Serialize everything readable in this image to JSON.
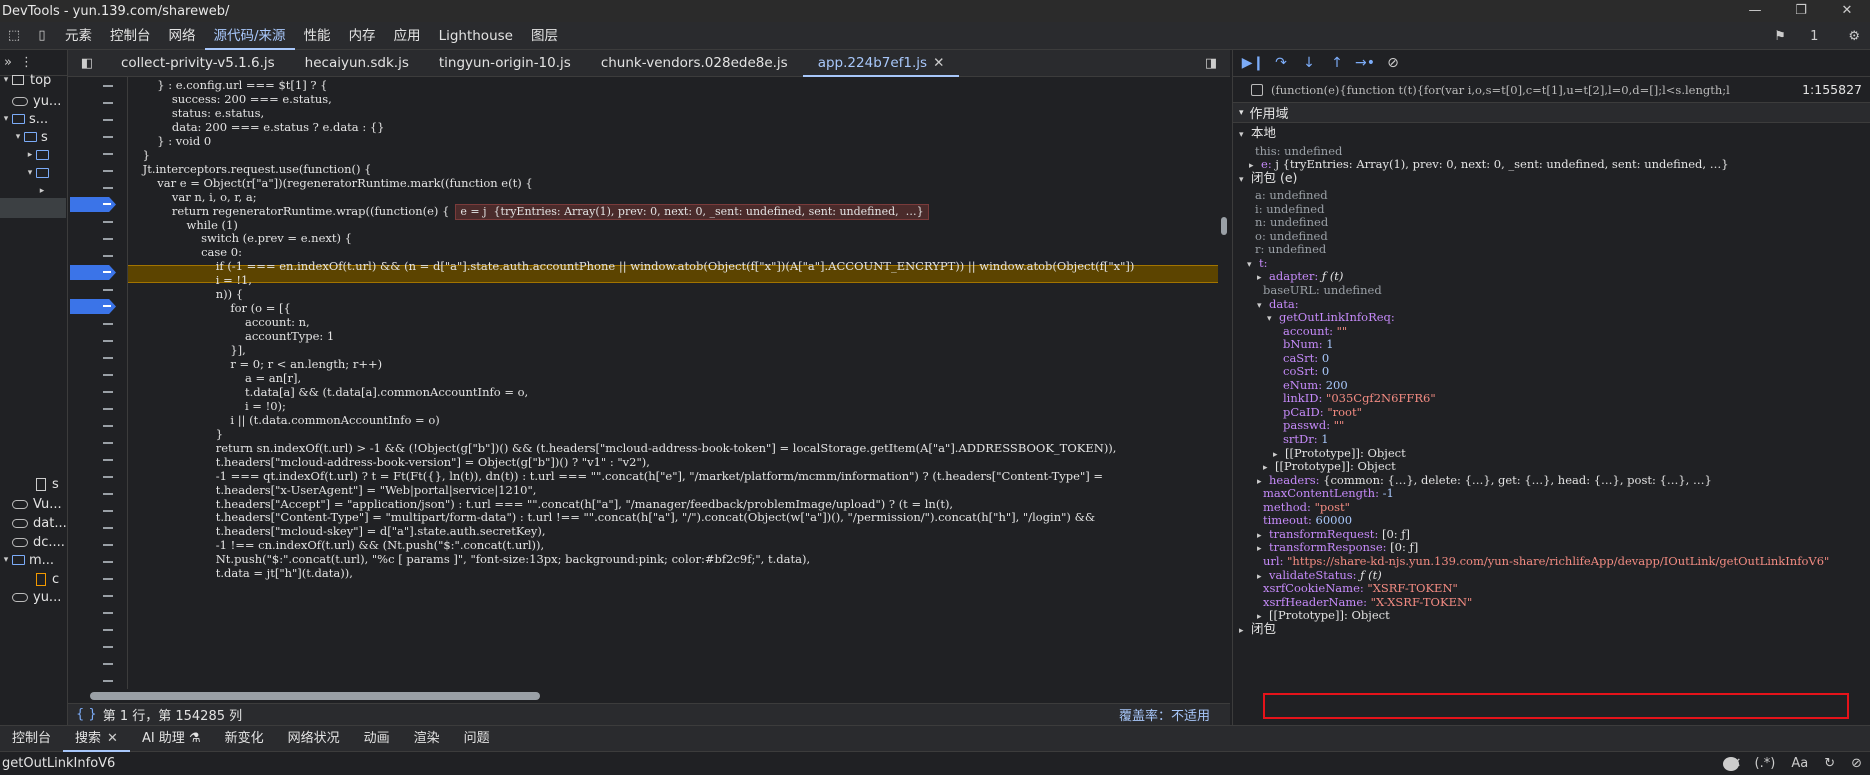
{
  "window": {
    "title": "DevTools - yun.139.com/shareweb/"
  },
  "main_tabs": [
    "元素",
    "控制台",
    "网络",
    "源代码/来源",
    "性能",
    "内存",
    "应用",
    "Lighthouse",
    "图层"
  ],
  "active_main_tab": "源代码/来源",
  "issues_count": "1",
  "file_tree": [
    {
      "label": "top",
      "icon": "window-icon"
    },
    {
      "label": "yu...",
      "icon": "cloud-icon"
    },
    {
      "label": "s...",
      "icon": "folder-icon"
    },
    {
      "label": "s",
      "icon": "folder-icon"
    },
    {
      "label": "",
      "icon": "folder-icon"
    },
    {
      "label": "",
      "icon": "folder-icon"
    },
    {
      "label": "s",
      "icon": "file-icon"
    },
    {
      "label": "Vu...",
      "icon": "cloud-icon"
    },
    {
      "label": "dat...",
      "icon": "cloud-icon"
    },
    {
      "label": "dc....",
      "icon": "cloud-icon"
    },
    {
      "label": "m...",
      "icon": "folder-icon"
    },
    {
      "label": "c",
      "icon": "file-icon"
    },
    {
      "label": "yu...",
      "icon": "cloud-icon"
    }
  ],
  "editor_tabs": [
    "collect-privity-v5.1.6.js",
    "hecaiyun.sdk.js",
    "tingyun-origin-10.js",
    "chunk-vendors.028ede8e.js",
    "app.224b7ef1.js"
  ],
  "active_editor_tab": "app.224b7ef1.js",
  "code_lines": [
    "        } : e.config.url === $t[1] ? {",
    "            success: 200 === e.status,",
    "            status: e.status,",
    "            data: 200 === e.status ? e.data : {}",
    "        } : void 0",
    "    }",
    "    Jt.interceptors.request.use(function() {",
    "        var e = Object(r[\"a\"])(regeneratorRuntime.mark((function e(t) {",
    "            var n, i, o, r, a;",
    "            return regeneratorRuntime.wrap((function(e) {",
    "                while (1)",
    "                    switch (e.prev = e.next) {",
    "                    case 0:",
    "                        if (-1 === en.indexOf(t.url) && (n = d[\"a\"].state.auth.accountPhone || window.atob(Object(f[\"x\"])(A[\"a\"].ACCOUNT_ENCRYPT)) || window.atob(Object(f[\"x\"])",
    "                        i = !1,",
    "                        n)) {",
    "                            for (o = [{",
    "                                account: n,",
    "                                accountType: 1",
    "                            }],",
    "                            r = 0; r < an.length; r++)",
    "                                a = an[r],",
    "                                t.data[a] && (t.data[a].commonAccountInfo = o,",
    "                                i = !0);",
    "                            i || (t.data.commonAccountInfo = o)",
    "                        }",
    "                        return sn.indexOf(t.url) > -1 && (!Object(g[\"b\"])() && (t.headers[\"mcloud-address-book-token\"] = localStorage.getItem(A[\"a\"].ADDRESSBOOK_TOKEN)),",
    "                        t.headers[\"mcloud-address-book-version\"] = Object(g[\"b\"])() ? \"v1\" : \"v2\"),",
    "                        -1 === qt.indexOf(t.url) ? t = Ft(Ft({}, ln(t)), dn(t)) : t.url === \"\".concat(h[\"e\"], \"/market/platform/mcmm/information\") ? (t.headers[\"Content-Type\"] =",
    "                        t.headers[\"x-UserAgent\"] = \"Web|portal|service|1210\",",
    "                        t.headers[\"Accept\"] = \"application/json\") : t.url === \"\".concat(h[\"a\"], \"/manager/feedback/problemImage/upload\") ? (t = ln(t),",
    "                        t.headers[\"Content-Type\"] = \"multipart/form-data\") : t.url !== \"\".concat(h[\"a\"], \"/\").concat(Object(w[\"a\"])(), \"/permission/\").concat(h[\"h\"], \"/login\") &&",
    "                        t.headers[\"mcloud-skey\"] = d[\"a\"].state.auth.secretKey),",
    "                        -1 !== cn.indexOf(t.url) && (Nt.push(\"$:\".concat(t.url)),",
    "                        Nt.push(\"$:\".concat(t.url), \"%c [ params ]\", \"font-size:13px; background:pink; color:#bf2c9f;\", t.data),",
    "                        t.data = jt[\"h\"](t.data)),"
  ],
  "inline_hint": "e = j  {tryEntries: Array(1), prev: 0, next: 0, _sent: undefined, sent: undefined,  …}",
  "status": {
    "position": "第 1 行，第 154285 列",
    "coverage": "覆盖率：不适用"
  },
  "breakpoint": {
    "source": "(function(e){function t(t){for(var i,o,s=t[0],c=t[1],u=t[2],l=0,d=[];l<s.length;l++)o=…",
    "position": "1:155827"
  },
  "scope": {
    "title": "作用域",
    "local_title": "本地",
    "local": [
      {
        "key": "this",
        "value": "undefined"
      },
      {
        "key": "e",
        "value": "j  {tryEntries: Array(1), prev: 0, next: 0, _sent: undefined, sent: undefined,  …}"
      }
    ],
    "closure_title": "闭包 (e)",
    "closure": [
      {
        "key": "a",
        "value": "undefined"
      },
      {
        "key": "i",
        "value": "undefined"
      },
      {
        "key": "n",
        "value": "undefined"
      },
      {
        "key": "o",
        "value": "undefined"
      },
      {
        "key": "r",
        "value": "undefined"
      },
      {
        "key": "t",
        "value": ""
      },
      {
        "key": "adapter",
        "value": "ƒ (t)"
      },
      {
        "key": "baseURL",
        "value": "undefined"
      },
      {
        "key": "data",
        "value": ""
      },
      {
        "key": "getOutLinkInfoReq",
        "value": ""
      },
      {
        "key": "account",
        "value": "\"\""
      },
      {
        "key": "bNum",
        "value": "1"
      },
      {
        "key": "caSrt",
        "value": "0"
      },
      {
        "key": "coSrt",
        "value": "0"
      },
      {
        "key": "eNum",
        "value": "200"
      },
      {
        "key": "linkID",
        "value": "\"035Cgf2N6FFR6\""
      },
      {
        "key": "pCaID",
        "value": "\"root\""
      },
      {
        "key": "passwd",
        "value": "\"\""
      },
      {
        "key": "srtDr",
        "value": "1"
      },
      {
        "key": "[[Prototype]]",
        "value": "Object"
      },
      {
        "key": "[[Prototype]]",
        "value": "Object"
      },
      {
        "key": "headers",
        "value": "{common: {…}, delete: {…}, get: {…}, head: {…}, post: {…},  …}"
      },
      {
        "key": "maxContentLength",
        "value": "-1"
      },
      {
        "key": "method",
        "value": "\"post\""
      },
      {
        "key": "timeout",
        "value": "60000"
      },
      {
        "key": "transformRequest",
        "value": "[0: ƒ]"
      },
      {
        "key": "transformResponse",
        "value": "[0: ƒ]"
      },
      {
        "key": "url",
        "value": "\"https://share-kd-njs.yun.139.com/yun-share/richlifeApp/devapp/IOutLink/getOutLinkInfoV6\""
      },
      {
        "key": "validateStatus",
        "value": "ƒ (t)"
      },
      {
        "key": "xsrfCookieName",
        "value": "\"XSRF-TOKEN\""
      },
      {
        "key": "xsrfHeaderName",
        "value": "\"X-XSRF-TOKEN\""
      },
      {
        "key": "[[Prototype]]",
        "value": "Object"
      }
    ],
    "closure2_title": "闭包"
  },
  "drawer_tabs": [
    "控制台",
    "搜索",
    "AI 助理 ⚗",
    "新变化",
    "网络状况",
    "动画",
    "渲染",
    "问题"
  ],
  "active_drawer_tab": "搜索",
  "search": {
    "query": "getOutLinkInfoV6",
    "regex_label": "(.*)",
    "case_label": "Aa"
  }
}
